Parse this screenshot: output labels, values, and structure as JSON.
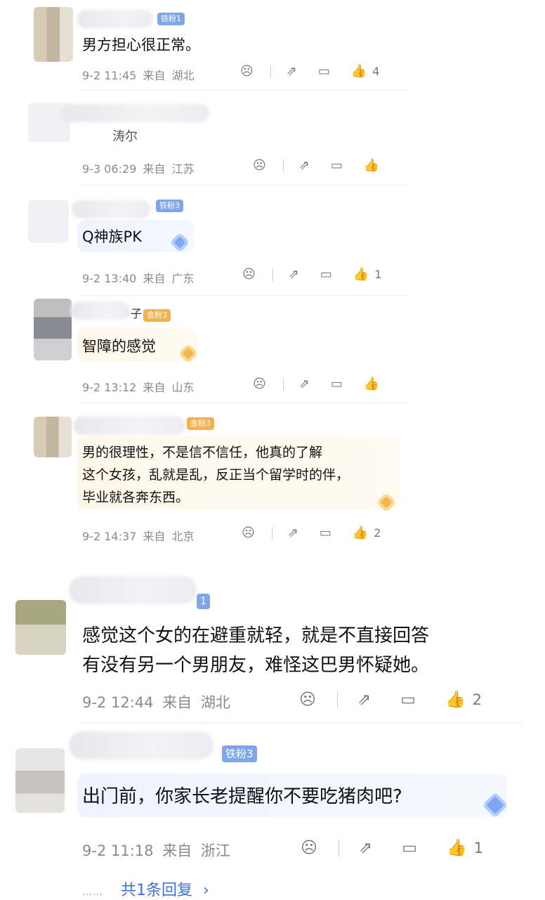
{
  "comments": [
    {
      "badge": "铁粉1",
      "text": "男方担心很正常。",
      "date": "9-2 11:45",
      "from": "来自",
      "region": "湖北",
      "likes": "4"
    },
    {
      "badge": "",
      "name_tail": "涛尔",
      "text": "",
      "date": "9-3 06:29",
      "from": "来自",
      "region": "江苏",
      "likes": ""
    },
    {
      "badge": "铁粉3",
      "text": "Q神族PK",
      "date": "9-2 13:40",
      "from": "来自",
      "region": "广东",
      "likes": "1"
    },
    {
      "badge": "金粉3",
      "name_tail": "子",
      "text": "智障的感觉",
      "date": "9-2 13:12",
      "from": "来自",
      "region": "山东",
      "likes": ""
    },
    {
      "badge": "金粉3",
      "text_lines": [
        "男的很理性，不是信不信任，他真的了解",
        "这个女孩，乱就是乱，反正当个留学时的伴，",
        "毕业就各奔东西。"
      ],
      "date": "9-2 14:37",
      "from": "来自",
      "region": "北京",
      "likes": "2"
    },
    {
      "badge": "1",
      "text_lines": [
        "感觉这个女的在避重就轻，就是不直接回答",
        "有没有另一个男朋友，难怪这巴男怀疑她。"
      ],
      "date": "9-2 12:44",
      "from": "来自",
      "region": "湖北",
      "likes": "2"
    },
    {
      "badge": "铁粉3",
      "text": "出门前，你家长老提醒你不要吃猪肉吧?",
      "date": "9-2 11:18",
      "from": "来自",
      "region": "浙江",
      "likes": "1"
    }
  ],
  "reply_more": {
    "dots": "……",
    "label": "共1条回复",
    "arrow": "›"
  },
  "icons": {
    "reaction": "frown-face-icon",
    "share": "share-icon",
    "reply": "comment-icon",
    "like": "thumbs-up-icon"
  },
  "colors": {
    "iron_badge": "#7fa6e8",
    "gold_badge": "#f2b24c",
    "link": "#3e72d8",
    "meta": "#8a8a8a"
  }
}
